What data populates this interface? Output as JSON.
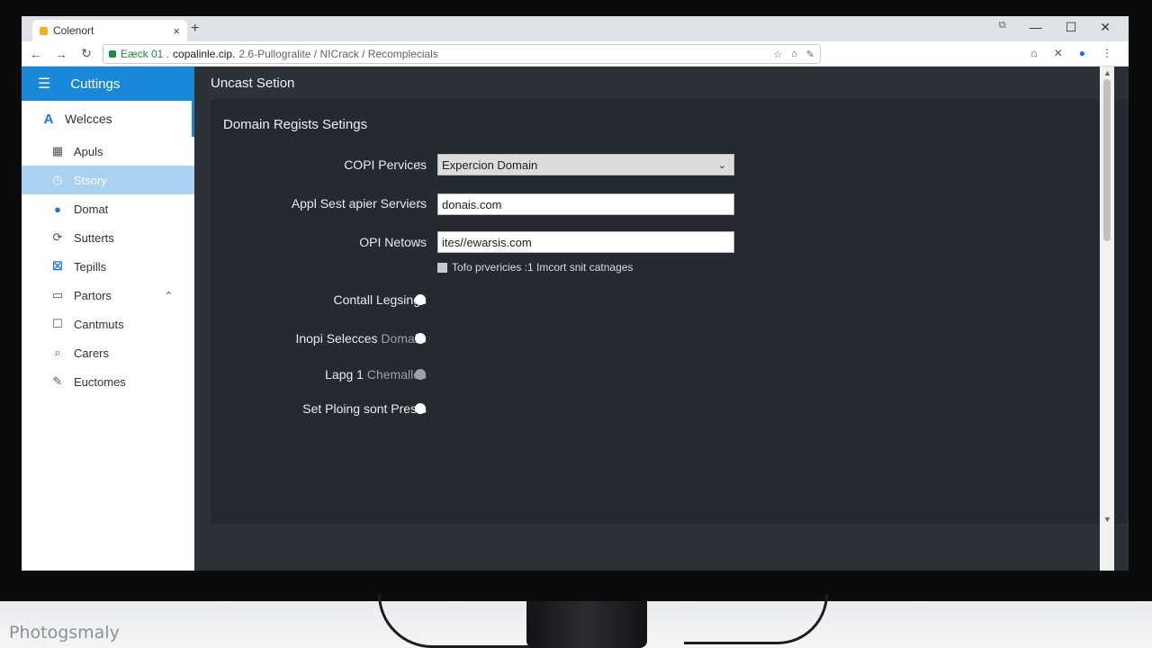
{
  "browser": {
    "tab_title": "Colenort",
    "tab_close": "×",
    "new_tab": "+",
    "url_secure": "Eæck 01 .",
    "url_host": "copalinle.cip.",
    "url_path": "2.6-Pullogralite / NICrack / Recomplecials"
  },
  "sidebar": {
    "header": "Cuttings",
    "welcome": "Welcces",
    "items": [
      {
        "label": "Apuls",
        "icon": "calendar-icon"
      },
      {
        "label": "Stsory",
        "icon": "clock-icon"
      },
      {
        "label": "Domat",
        "icon": "domain-icon"
      },
      {
        "label": "Sutterts",
        "icon": "cycle-icon"
      },
      {
        "label": "Tepills",
        "icon": "x-box-icon"
      },
      {
        "label": "Partors",
        "icon": "folder-icon"
      },
      {
        "label": "Cantmuts",
        "icon": "chat-icon"
      },
      {
        "label": "Carers",
        "icon": "search-icon"
      },
      {
        "label": "Euctomes",
        "icon": "wrench-icon"
      }
    ]
  },
  "content": {
    "section_title": "Uncast Setion",
    "panel_title": "Domain Regists Setings",
    "fields": {
      "copi_label": "COPI Pervices",
      "copi_value": "Expercion Domain",
      "appl_label": "Appl Sest apier Serviers",
      "appl_value": "donais.com",
      "opi_label": "OPI Netows",
      "opi_value": "ites//ewarsis.com",
      "checkbox_label": "Tofo prvericies :1 Imcort snit catnages"
    },
    "toggles": [
      {
        "label": "Contall Legsings",
        "muted": ""
      },
      {
        "label": "Inopi Selecces",
        "muted": "Domails"
      },
      {
        "label": "Lapg 1",
        "muted": "Chemalles"
      },
      {
        "label": "Set Ploing sont Prests",
        "muted": ""
      }
    ]
  },
  "watermark": "Photogsmaly"
}
